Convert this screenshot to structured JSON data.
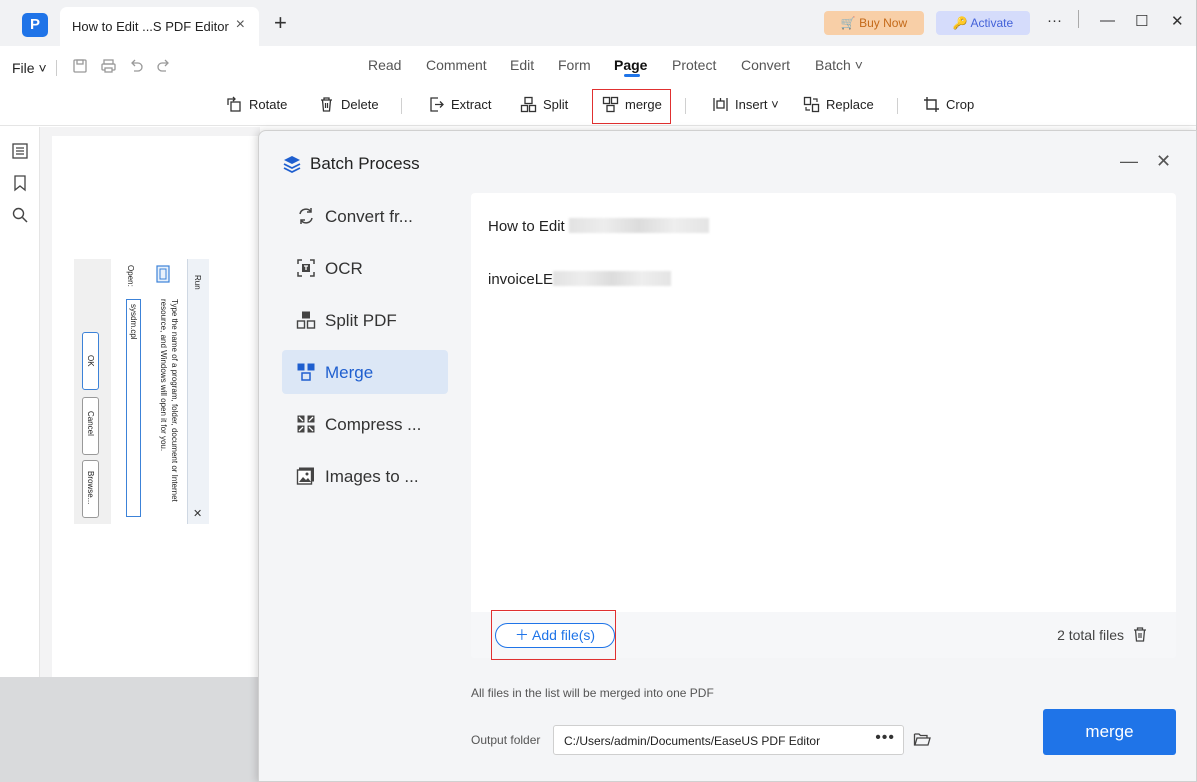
{
  "window": {
    "tab_title": "How to Edit ...S PDF Editor",
    "buy_now": "Buy Now",
    "activate": "Activate"
  },
  "menu": {
    "file": "File",
    "items": [
      "Read",
      "Comment",
      "Edit",
      "Form",
      "Page",
      "Protect",
      "Convert",
      "Batch"
    ],
    "active": "Page"
  },
  "toolbar": {
    "rotate": "Rotate",
    "delete": "Delete",
    "extract": "Extract",
    "split": "Split",
    "merge": "merge",
    "insert": "Insert",
    "replace": "Replace",
    "crop": "Crop"
  },
  "run_dialog": {
    "title": "Run",
    "description": "Type the name of a program, folder, document or Internet resource, and Windows will open it for you.",
    "open_label": "Open:",
    "open_value": "sysdm.cpl",
    "ok": "OK",
    "cancel": "Cancel",
    "browse": "Browse..."
  },
  "batch": {
    "title": "Batch Process",
    "sidebar": [
      {
        "label": "Convert fr..."
      },
      {
        "label": "OCR"
      },
      {
        "label": "Split PDF"
      },
      {
        "label": "Merge"
      },
      {
        "label": "Compress ..."
      },
      {
        "label": "Images to ..."
      }
    ],
    "active_item": "Merge",
    "files": [
      {
        "name": "How to Edit "
      },
      {
        "name": "invoiceLE"
      }
    ],
    "add_files": "Add file(s)",
    "total_files": "2 total files",
    "hint": "All files in the list will be merged into one PDF",
    "output_label": "Output folder",
    "output_path": "C:/Users/admin/Documents/EaseUS PDF Editor",
    "merge_button": "merge"
  },
  "colors": {
    "accent": "#1f74e8",
    "highlight_box": "#e03030"
  }
}
